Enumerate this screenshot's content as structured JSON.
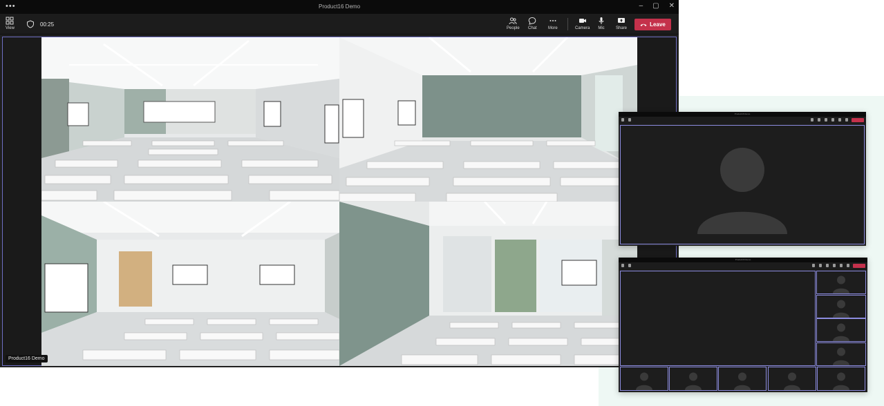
{
  "window": {
    "title": "Product16 Demo",
    "menu_glyph": "•••",
    "controls": [
      "–",
      "▢",
      "✕"
    ]
  },
  "toolbar": {
    "view_label": "View",
    "timer": "00:25",
    "people_label": "People",
    "chat_label": "Chat",
    "more_label": "More",
    "camera_label": "Camera",
    "mic_label": "Mic",
    "share_label": "Share",
    "leave_label": "Leave"
  },
  "stage": {
    "name_tag": "Product16 Demo",
    "tiles": [
      "classroom-front-view",
      "classroom-side-view",
      "classroom-rear-view",
      "classroom-window-view"
    ]
  },
  "mini_windows": [
    {
      "id": "speaker-layout",
      "participants": 1
    },
    {
      "id": "gallery-layout",
      "participants": 10
    }
  ],
  "colors": {
    "accent_border": "#6f6fc4",
    "leave": "#c4314b",
    "background_mint": "#eef8f4"
  }
}
